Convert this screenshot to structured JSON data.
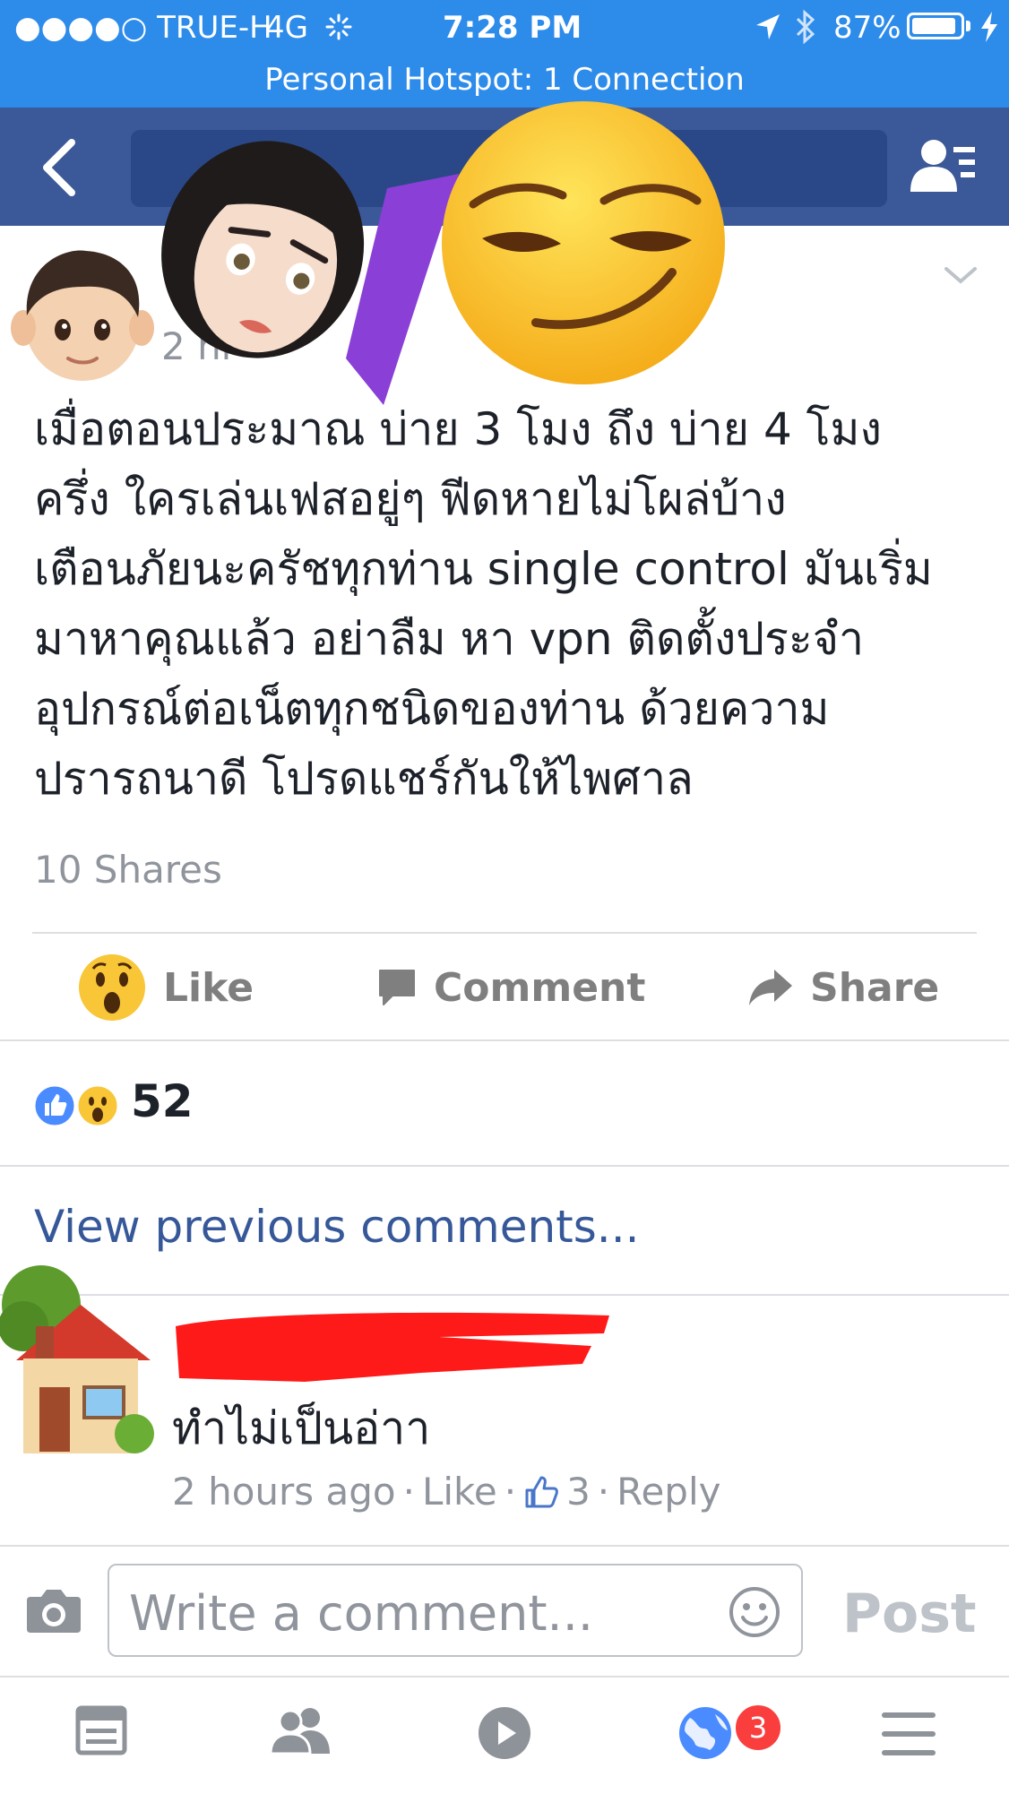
{
  "status_bar": {
    "carrier": "●●●●○ TRUE-H",
    "network": "4G",
    "time": "7:28 PM",
    "battery": "87%"
  },
  "hotspot_banner": "Personal Hotspot: 1 Connection",
  "post": {
    "time_partial": "2 hr",
    "text_lines": [
      "เมื่อตอนประมาณ บ่าย 3 โมง ถึง บ่าย 4 โมง",
      "ครึ่ง ใครเล่นเฟสอยู่ๆ ฟีดหายไม่โผล่บ้าง",
      "เตือนภัยนะครัชทุกท่าน single control มันเริ่ม",
      "มาหาคุณแล้ว อย่าลืม หา vpn ติดตั้งประจำ",
      "อุปกรณ์ต่อเน็ตทุกชนิดของท่าน ด้วยความ",
      "ปรารถนาดี โปรดแชร์กันให้ไพศาล"
    ],
    "shares": "10 Shares"
  },
  "actions": {
    "like": "Like",
    "comment": "Comment",
    "share": "Share"
  },
  "reactions": {
    "count": "52"
  },
  "comments": {
    "view_previous": "View previous comments...",
    "items": [
      {
        "text": "ทำไม่เป็นอ่าา",
        "time": "2 hours ago",
        "like_label": "Like",
        "like_count": "3",
        "reply_label": "Reply"
      }
    ]
  },
  "composer": {
    "placeholder": "Write a comment...",
    "post_label": "Post"
  },
  "tab_bar": {
    "notifications_badge": "3"
  },
  "colors": {
    "status_bar": "#2d8bea",
    "nav_bar": "#3b5998",
    "link": "#365899",
    "muted": "#90949c",
    "badge": "#fa3e3e"
  },
  "icons": [
    "back-arrow-icon",
    "friend-requests-icon",
    "chevron-down-icon",
    "surprised-emoji-icon",
    "comment-bubble-icon",
    "share-arrow-icon",
    "like-reaction-icon",
    "wow-reaction-icon",
    "camera-icon",
    "smiley-icon",
    "news-feed-icon",
    "friends-icon",
    "video-icon",
    "globe-icon",
    "menu-icon"
  ]
}
